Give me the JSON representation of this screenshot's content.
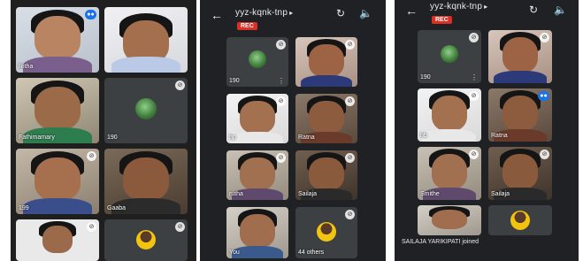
{
  "panel1": {
    "tiles": [
      {
        "name": "Ritha"
      },
      {
        "name": ""
      },
      {
        "name": "Fathimamary"
      },
      {
        "name": "190"
      },
      {
        "name": "199"
      },
      {
        "name": "Gaaba"
      },
      {
        "name": ""
      },
      {
        "name": ""
      }
    ]
  },
  "meet": {
    "title": "yyz-kqnk-tnp",
    "rec_label": "REC"
  },
  "panel2": {
    "tiles": [
      {
        "name": "190"
      },
      {
        "name": ""
      },
      {
        "name": "hp"
      },
      {
        "name": "Ratna"
      },
      {
        "name": "rutha"
      },
      {
        "name": "Sailaja"
      },
      {
        "name": "You"
      },
      {
        "name": "44 others"
      }
    ]
  },
  "panel3": {
    "tiles": [
      {
        "name": "190"
      },
      {
        "name": ""
      },
      {
        "name": "hb"
      },
      {
        "name": "Ratna"
      },
      {
        "name": "Smithe"
      },
      {
        "name": "Sailaja"
      },
      {
        "name": ""
      },
      {
        "name": ""
      }
    ],
    "toast": "SAILAJA YARIKIPATI joined"
  },
  "icons": {
    "back": "arrow-left-icon",
    "switch_camera": "switch-camera-icon",
    "speaker": "speaker-icon",
    "mic_off": "mic-off-icon",
    "speaking": "speaking-indicator-icon",
    "more": "more-vert-icon"
  },
  "colors": {
    "rec": "#d93025",
    "speaking": "#1a73e8",
    "tile_bg": "#3c4043",
    "app_bg": "#202124"
  }
}
